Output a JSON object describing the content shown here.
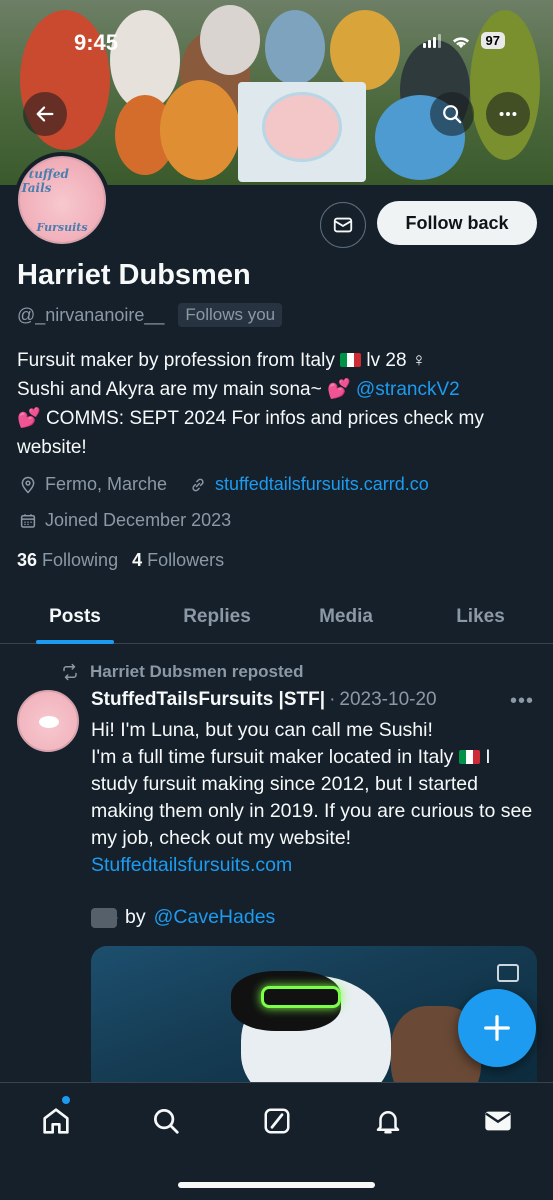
{
  "status_bar": {
    "time": "9:45",
    "battery": "97"
  },
  "banner": {
    "flag_text": "Stuffed Tails Fursuits"
  },
  "profile": {
    "name": "Harriet Dubsmen",
    "handle": "@_nirvananoire__",
    "follows_you": "Follows you",
    "follow_button": "Follow back",
    "avatar_text_top": "Stuffed Tails",
    "avatar_text_bottom": "Fursuits",
    "bio_line1": "Fursuit maker by profession from Italy",
    "bio_line1_tail": "lv 28 ♀",
    "bio_line2": "Sushi and Akyra are my main sona~",
    "bio_mention": "@stranckV2",
    "bio_line3": "COMMS: SEPT 2024 For infos and prices check my website!",
    "location": "Fermo, Marche",
    "website": "stuffedtailsfursuits.carrd.co",
    "joined": "Joined December 2023",
    "following_count": "36",
    "following_label": "Following",
    "followers_count": "4",
    "followers_label": "Followers"
  },
  "tabs": [
    {
      "label": "Posts",
      "active": true
    },
    {
      "label": "Replies",
      "active": false
    },
    {
      "label": "Media",
      "active": false
    },
    {
      "label": "Likes",
      "active": false
    }
  ],
  "tweet": {
    "repost_label": "Harriet Dubsmen reposted",
    "author": "StuffedTailsFursuits |STF|",
    "separator": "·",
    "date": "2023-10-20",
    "more": "•••",
    "body_line1": "Hi! I'm Luna, but you can call me Sushi!",
    "body_line2a": "I'm a full time fursuit maker located in Italy",
    "body_line2b": "I study fursuit making since 2012, but I started making them only in 2019. If you are curious to see my job, check out my website!",
    "link": "Stuffedtailsfursuits.com",
    "credit_by": "by",
    "credit_mention": "@CaveHades"
  },
  "colors": {
    "accent": "#1d9bf0",
    "background": "#15202b",
    "muted": "#8b98a5",
    "divider": "#38444d"
  },
  "icons": {
    "back": "arrow-left-icon",
    "search": "search-icon",
    "more": "more-icon",
    "mail": "envelope-icon",
    "location": "location-pin-icon",
    "link": "link-icon",
    "calendar": "calendar-icon",
    "repost": "repost-icon",
    "compose": "plus-icon",
    "nav_home": "home-icon",
    "nav_search": "search-icon",
    "nav_grok": "grok-icon",
    "nav_notifications": "bell-icon",
    "nav_messages": "envelope-icon"
  }
}
